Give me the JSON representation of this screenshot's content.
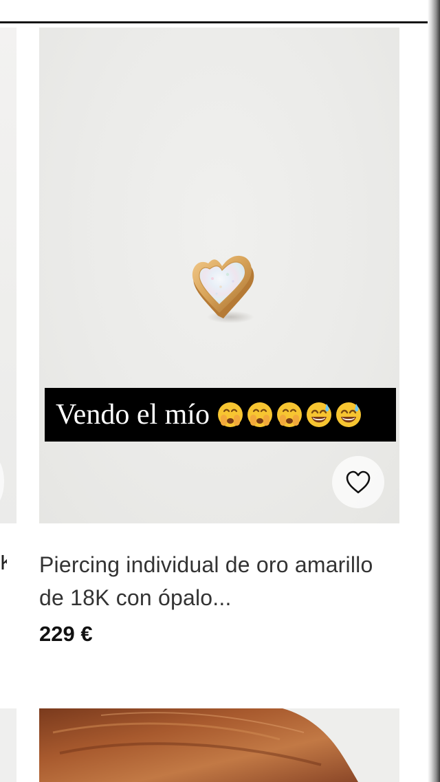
{
  "caption": {
    "text": "Vendo el mío",
    "emojis": [
      "face-with-hand-over-mouth",
      "face-with-hand-over-mouth",
      "face-with-hand-over-mouth",
      "grinning-face-with-sweat",
      "grinning-face-with-sweat"
    ]
  },
  "product": {
    "title": "Piercing individual de oro amarillo de 18K con ópalo...",
    "price": "229 €",
    "image_icon": "heart-opal-earring-image",
    "favorite_icon": "heart-outline-icon"
  },
  "left_card": {
    "title_fragment": "K"
  },
  "colors": {
    "caption_background": "#000000",
    "caption_text": "#ffffff",
    "price_text": "#111111",
    "title_text": "#333333",
    "image_background": "#ebebe9",
    "gold": "#d9a55b"
  }
}
